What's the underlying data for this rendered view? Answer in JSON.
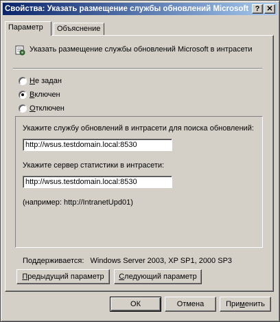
{
  "window": {
    "title": "Свойства: Указать размещение службы обновлений Microsoft в интрасети",
    "help_button": "?",
    "close_button": "✕"
  },
  "tabs": [
    {
      "label": "Параметр",
      "active": true
    },
    {
      "label": "Объяснение",
      "active": false
    }
  ],
  "policy": {
    "title": "Указать размещение службы обновлений Microsoft в интрасети",
    "icon": "policy-settings-icon"
  },
  "radios": [
    {
      "accel": "Н",
      "rest": "е задан",
      "checked": false
    },
    {
      "accel": "В",
      "rest": "ключен",
      "checked": true
    },
    {
      "accel": "О",
      "rest": "тключен",
      "checked": false
    }
  ],
  "options": {
    "update_service_label": "Укажите службу обновлений в интрасети для поиска обновлений:",
    "update_service_value": "http://wsus.testdomain.local:8530",
    "stats_server_label": "Укажите сервер статистики в интрасети:",
    "stats_server_value": "http://wsus.testdomain.local:8530",
    "example": "(например: http://IntranetUpd01)"
  },
  "supported": {
    "label": "Поддерживается:",
    "value": "Windows Server 2003, XP SP1, 2000 SP3"
  },
  "nav_buttons": {
    "prev_accel": "П",
    "prev_rest": "редыдущий параметр",
    "next_accel": "С",
    "next_rest": "ледующий параметр"
  },
  "dialog_buttons": {
    "ok": "ОК",
    "cancel": "Отмена",
    "apply_pre": "При",
    "apply_accel": "м",
    "apply_post": "енить"
  }
}
